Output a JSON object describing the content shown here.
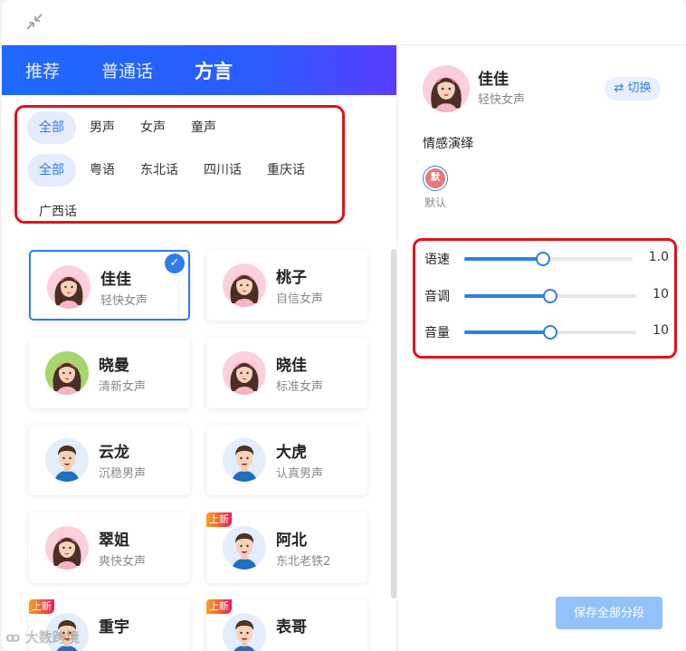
{
  "tabs": [
    {
      "label": "推荐"
    },
    {
      "label": "普通话"
    },
    {
      "label": "方言",
      "active": true
    }
  ],
  "gender_filters": [
    {
      "label": "全部",
      "active": true
    },
    {
      "label": "男声"
    },
    {
      "label": "女声"
    },
    {
      "label": "童声"
    }
  ],
  "dialect_filters": [
    {
      "label": "全部",
      "active": true
    },
    {
      "label": "粤语"
    },
    {
      "label": "东北话"
    },
    {
      "label": "四川话"
    },
    {
      "label": "重庆话"
    },
    {
      "label": "广西话"
    }
  ],
  "voices": [
    {
      "name": "佳佳",
      "desc": "轻快女声",
      "avatar": "female",
      "selected": true
    },
    {
      "name": "桃子",
      "desc": "自信女声",
      "avatar": "female"
    },
    {
      "name": "晓曼",
      "desc": "清新女声",
      "avatar": "female-green"
    },
    {
      "name": "晓佳",
      "desc": "标准女声",
      "avatar": "female"
    },
    {
      "name": "云龙",
      "desc": "沉稳男声",
      "avatar": "male"
    },
    {
      "name": "大虎",
      "desc": "认真男声",
      "avatar": "male"
    },
    {
      "name": "翠姐",
      "desc": "爽快女声",
      "avatar": "female"
    },
    {
      "name": "阿北",
      "desc": "东北老铁2",
      "avatar": "male",
      "badge": "上新"
    },
    {
      "name": "重宇",
      "desc": "",
      "avatar": "male",
      "badge": "上新"
    },
    {
      "name": "表哥",
      "desc": "",
      "avatar": "male",
      "badge": "上新"
    }
  ],
  "current": {
    "name": "佳佳",
    "desc": "轻快女声",
    "switch_label": "⇄ 切换"
  },
  "emotion": {
    "title": "情感演绎",
    "badge": "默",
    "name": "默认"
  },
  "sliders": [
    {
      "label": "语速",
      "value": "1.0",
      "fraction": 0.47
    },
    {
      "label": "音调",
      "value": "10",
      "fraction": 0.5
    },
    {
      "label": "音量",
      "value": "10",
      "fraction": 0.5
    }
  ],
  "save_label": "保存全部分段",
  "watermark": "大数跨境",
  "colors": {
    "accent": "#2f7de8",
    "highlight": "#e0141a",
    "tab_start": "#1f68ff",
    "tab_end": "#5a3cff"
  }
}
